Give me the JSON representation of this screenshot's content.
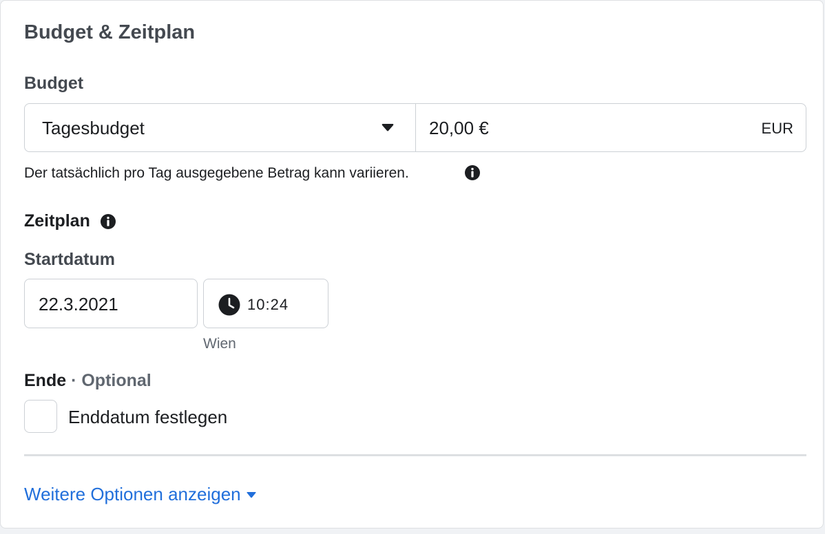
{
  "section": {
    "title": "Budget & Zeitplan"
  },
  "budget": {
    "label": "Budget",
    "type_selected": "Tagesbudget",
    "amount": "20,00 €",
    "currency": "EUR",
    "note": "Der tatsächlich pro Tag ausgegebene Betrag kann variieren."
  },
  "schedule": {
    "label": "Zeitplan",
    "start_label": "Startdatum",
    "start_date": "22.3.2021",
    "start_time": "10:24",
    "timezone": "Wien",
    "end_label": "Ende",
    "end_separator": "·",
    "end_optional": "Optional",
    "end_checkbox_label": "Enddatum festlegen",
    "end_checkbox_checked": false
  },
  "more_options": {
    "label": "Weitere Optionen anzeigen"
  },
  "colors": {
    "link": "#216fdb",
    "text": "#1c1e21",
    "muted": "#606770",
    "border": "#ccd0d5"
  },
  "icons": {
    "caret": "caret-down-icon",
    "info": "info-icon",
    "clock": "clock-icon"
  }
}
